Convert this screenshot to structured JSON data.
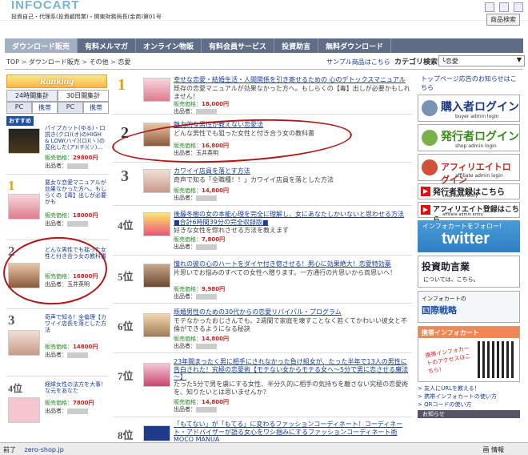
{
  "header": {
    "logo": "INFOCART",
    "subtitle": "投資自己・代理系(投資顧問業)・関東財務局長(金商)第01号",
    "site_search": "商品検索"
  },
  "nav": [
    "ダウンロード販売",
    "有料メルマガ",
    "オンライン物販",
    "有料会員サービス",
    "投資助言",
    "無料ダウンロード"
  ],
  "breadcrumb": {
    "top": "TOP",
    "sep": " > ",
    "download": "ダウンロード販売",
    "other": "その他",
    "current": "恋愛"
  },
  "sample_link": "サンプル商品はこちら",
  "category": {
    "label": "カテゴリ検索",
    "selected": "└恋愛"
  },
  "ranking": {
    "banner": "Ranking",
    "tabs": [
      "24時間集計",
      "30日間集計"
    ],
    "subtabs": [
      "PC",
      "携帯",
      "PC",
      "携帯"
    ],
    "left_items": [
      {
        "badge": "おすすめ",
        "title": "パイプカット(ゆる)・口説き(クロ)(オ)のHIGH & LOW(ハイ)(ロ)(ヽ)の変化した(ア)(チ)(ソ)…",
        "price": "29800円"
      },
      {
        "rank": "1",
        "title": "悪女な恋愛マニュアルが効果なかった方へ。もしらくの【毒】出しが必要かも",
        "price": "18000円"
      },
      {
        "rank": "2",
        "title": "どんな男性でも揺った女性と付き合う女の教科書",
        "price": "16800円",
        "author": "玉井英明"
      },
      {
        "rank": "3",
        "title": "奇声で知る！全倫理【カワイイ店長を落とした方法",
        "price": "14800円"
      },
      {
        "rank": "4位",
        "title": "経緯女性の法方を大事！な元をあなた",
        "price": "7800円"
      }
    ]
  },
  "center_items": [
    {
      "rank": "1",
      "title": "幸せな恋愛・結婚生活・人間関係を引き寄せるための 心のデトックスマニュアル",
      "desc": "既存の恋愛マニュアルが効果なかった方へ。もしらくの【毒】出しが必要かもしれません！",
      "price_label": "販売価格：",
      "price": "18,000円",
      "author_label": "出品者："
    },
    {
      "rank": "2",
      "title": "魅力的な男性が教えない恋愛法",
      "desc": "どんな男性でも狙った女性と付き合う女の教科書",
      "price_label": "販売価格：",
      "price": "16,800円",
      "author_label": "出品者：",
      "author": "玉井英明"
    },
    {
      "rank": "3",
      "title": "カワイイ店員を落とす方法",
      "desc": "奇声で知る「全職種！！」カワイイ店員を落とした方法",
      "price_label": "販売価格：",
      "price": "14,800円",
      "author_label": "出品者："
    },
    {
      "rank": "4位",
      "title": "後藤冬樹の女の本能心理を完全に理解し、女にあなたしかいないと思わせる方法 ■合計6時間39分の完全収録版■",
      "desc": "好きな女性を惚れさせる方法を教えます",
      "price_label": "販売価格：",
      "price": "7,800円",
      "author_label": "出品者："
    },
    {
      "rank": "5位",
      "title": "憧れの彼の心のハートをダイヤ付き惚させる！男心に効果絶大！恋愛特効薬",
      "desc": "片思いでお悩みのすべての女性へ贈ります。一方通行の片思いから両思いへ！",
      "price_label": "販売価格：",
      "price": "9,980円",
      "author_label": "出品者："
    },
    {
      "rank": "6位",
      "title": "既婚男性のための30代からの恋愛リバイバル・プログラム",
      "desc": "モテなかったおじさんでも、2週間で家庭を壊すことなく若くてかわいい彼女と不倫ができるようになる秘訣",
      "price_label": "販売価格：",
      "price": "14,800円",
      "author_label": "出品者："
    },
    {
      "rank": "7位",
      "title": "23年間まったく男に相手にされなかった負け組女が、たった半年で13人の男性に告白された！究極の恋愛術【モテない女からモテる女へ～5分で男に恋させる魔法～】",
      "desc": "たった5分で男を虜にする女性、半分久的に相手の気持ちを離さない究極の恋愛術を、知りたいとは思いませんか？",
      "price_label": "販売価格：",
      "price": "14,800円",
      "author_label": "出品者："
    },
    {
      "rank": "8位",
      "title": "「もてない」が「もてる」に変わるファッションコーディネート！コーディネート・アドバイザーが語る女心をワシ掴みにするファッションコーディネート術 MOCO MANUA",
      "desc": "",
      "price_label": "",
      "price": "",
      "author_label": ""
    }
  ],
  "right": {
    "head": "トップページ応告のお知らせはこちら",
    "buyer": {
      "big": "購入者ログイン",
      "small": "buyer admin login"
    },
    "seller": {
      "big": "発行者ログイン",
      "small": "shop admin login"
    },
    "affiliate": {
      "big": "アフィリエイトログイン",
      "small": "affiliate admin login"
    },
    "reg_seller": {
      "t": "発行者登録はこちら",
      "s": "shop admin entry"
    },
    "reg_aff": {
      "t": "アフィリエイト登録はこちら",
      "s": "affiliate admin entry"
    },
    "twitter": {
      "a": "インフォカートをフォロー!",
      "b": "twitter"
    },
    "toushi": {
      "a": "投資助言業",
      "b": "については、こちら。"
    },
    "kokusai": {
      "a": "インフォカートの",
      "b": "国際戦略"
    },
    "mobile": {
      "hd": "携帯インフォカート",
      "txt": "携帯インフォカートのアクセスはこちら!"
    },
    "links": [
      "> 友人にURLを教える！",
      "> 携帯インフォカートの使い方",
      "> QRコードの使い方"
    ],
    "info": "お知らせ"
  },
  "status": {
    "left": "前了",
    "url": "zero-shop.jp",
    "right": "画 情報"
  },
  "colors": {
    "nav": "#5f6e86",
    "link": "#1a3c9a",
    "price": "#d02020",
    "rank": "#e8a000",
    "ring": "#b01818"
  }
}
